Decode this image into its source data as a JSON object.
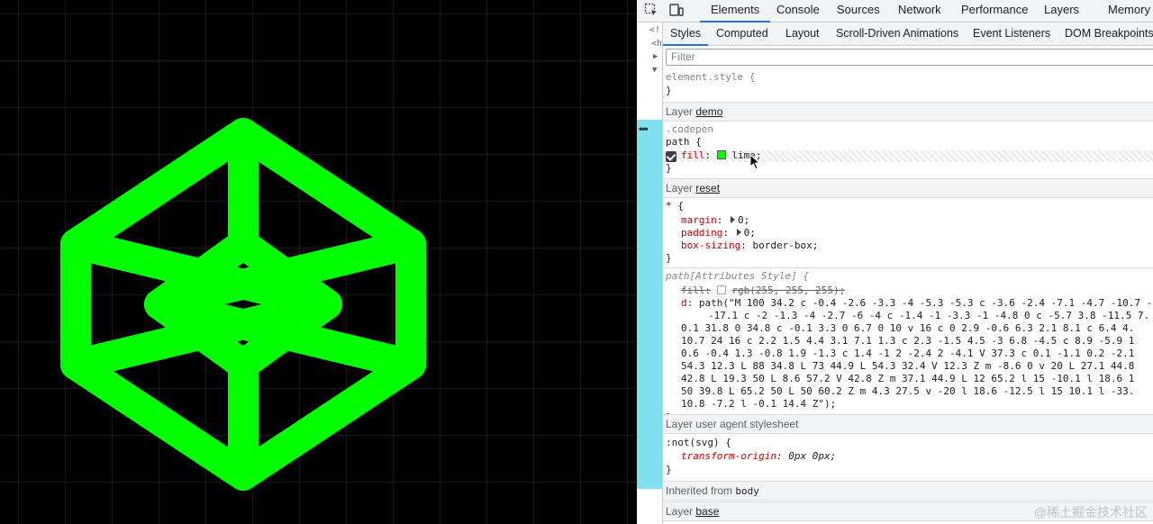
{
  "canvas": {
    "logo_color": "#00ff00",
    "background": "#000000"
  },
  "devtools": {
    "main_tabs": [
      "Elements",
      "Console",
      "Sources",
      "Network",
      "Performance",
      "Layers",
      "Memory"
    ],
    "active_main_tab": "Elements",
    "sub_tabs": [
      "Styles",
      "Computed",
      "Layout",
      "Scroll-Driven Animations",
      "Event Listeners",
      "DOM Breakpoints"
    ],
    "active_sub_tab": "Styles",
    "filter_placeholder": "Filter",
    "dom_fragments": [
      "<!",
      "<h",
      "▶",
      "▼"
    ],
    "element_style": {
      "selector": "element.style {",
      "close": "}"
    },
    "layer_demo": {
      "label": "Layer",
      "name": "demo"
    },
    "codepen_rule": {
      "selector_line1": ".codepen",
      "selector_line2": "path {",
      "prop": "fill",
      "value": "lime;",
      "swatch": "#00ff00",
      "close": "}"
    },
    "layer_reset": {
      "label": "Layer",
      "name": "reset"
    },
    "reset_rule": {
      "selector": "* {",
      "decls": [
        {
          "prop": "margin",
          "value": "0;"
        },
        {
          "prop": "padding",
          "value": "0;"
        },
        {
          "prop": "box-sizing",
          "value": "border-box;"
        }
      ],
      "close": "}"
    },
    "attr_rule": {
      "selector": "path[Attributes Style] {",
      "fill_prop": "fill:",
      "fill_value": "rgb(255, 255, 255);",
      "d_prop": "d:",
      "d_lines": [
        "path(\"M 100 34.2 c -0.4 -2.6 -3.3 -4 -5.3 -5.3 c -3.6 -2.4 -7.1 -4.7 -10.7 -",
        "-17.1 c -2 -1.3 -4 -2.7 -6 -4 c -1.4 -1 -3.3 -1 -4.8 0 c -5.7 3.8 -11.5 7.",
        "0.1 31.8 0 34.8 c -0.1 3.3 0 6.7 0 10 v 16 c 0 2.9 -0.6 6.3 2.1 8.1 c 6.4 4.",
        "10.7 24 16 c 2.2 1.5 4.4 3.1 7.1 1.3 c 2.3 -1.5 4.5 -3 6.8 -4.5 c 8.9 -5.9 1",
        "0.6 -0.4 1.3 -0.8 1.9 -1.3 c 1.4 -1 2 -2.4 2 -4.1 V 37.3 c 0.1 -1.1 0.2 -2.1",
        "54.3 12.3 L 88 34.8 L 73 44.9 L 54.3 32.4 V 12.3 Z m -8.6 0 v 20 L 27.1 44.8",
        "42.8 L 19.3 50 L 8.6 57.2 V 42.8 Z m 37.1 44.9 L 12 65.2 l 15 -10.1 l 18.6 1",
        "50 39.8 L 65.2 50 L 50 60.2 Z m 4.3 27.5 v -20 l 18.6 -12.5 l 15 10.1 l -33.",
        "10.8 -7.2 l -0.1 14.4 Z\");"
      ],
      "close": "}"
    },
    "layer_ua": {
      "label": "Layer user agent stylesheet"
    },
    "ua_rule": {
      "selector": ":not(svg) {",
      "prop": "transform-origin",
      "value": "0px 0px;",
      "close": "}"
    },
    "inherited": {
      "label": "Inherited from",
      "element": "body"
    },
    "layer_base": {
      "label": "Layer",
      "name": "base"
    }
  },
  "watermark": "@稀土掘金技术社区"
}
